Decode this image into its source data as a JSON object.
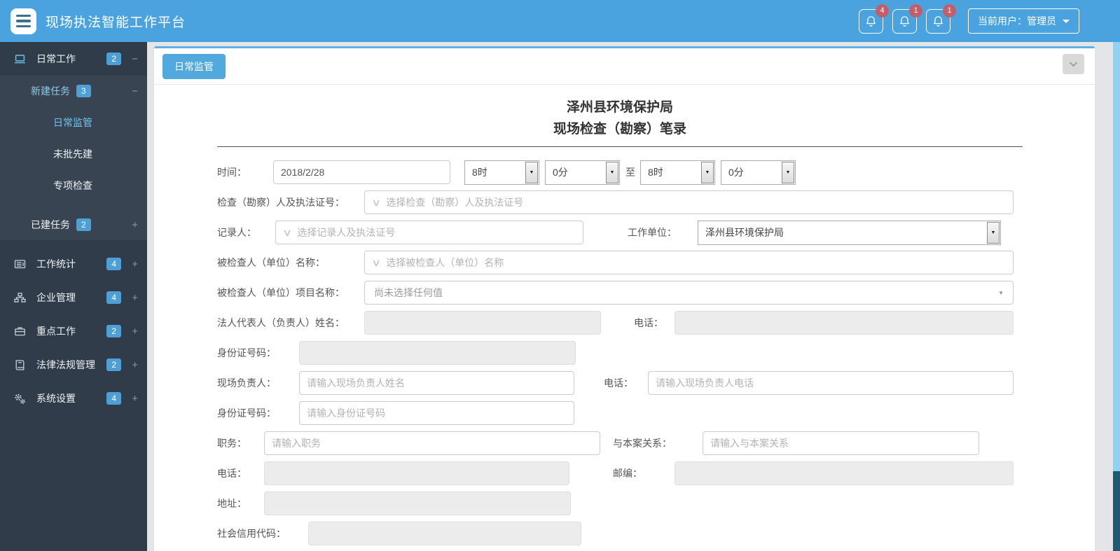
{
  "header": {
    "title": "现场执法智能工作平台",
    "notifications": [
      {
        "count": "4"
      },
      {
        "count": "1"
      },
      {
        "count": "1"
      }
    ],
    "user_label": "当前用户：管理员"
  },
  "icons": {
    "plus": "+",
    "minus": "−",
    "caret": "▼",
    "chevron": "∨"
  },
  "colors": {
    "header_bg": "#4AA3DF",
    "sidebar_bg": "#303C49",
    "submenu_bg": "#394452",
    "badge_bg": "#4E9FD6",
    "alert_badge_bg": "#CA5861",
    "active_text": "#6EC6F0",
    "tab_bg": "#52A9DD",
    "panel_top_border": "#5FB2E6",
    "scroll_thumb": "#8FD2F1",
    "scroll_track": "#1E5A74"
  },
  "sidebar": {
    "daily_work": {
      "label": "日常工作",
      "badge": "2"
    },
    "new_task": {
      "label": "新建任务",
      "badge": "3"
    },
    "children": [
      {
        "label": "日常监管"
      },
      {
        "label": "未批先建"
      },
      {
        "label": "专项检查"
      }
    ],
    "built_task": {
      "label": "已建任务",
      "badge": "2"
    },
    "items": [
      {
        "label": "工作统计",
        "badge": "4"
      },
      {
        "label": "企业管理",
        "badge": "4"
      },
      {
        "label": "重点工作",
        "badge": "2"
      },
      {
        "label": "法律法规管理",
        "badge": "2"
      },
      {
        "label": "系统设置",
        "badge": "4"
      }
    ]
  },
  "main": {
    "tab_label": "日常监管"
  },
  "form": {
    "title_line1": "泽州县环境保护局",
    "title_line2": "现场检查（勘察）笔录",
    "time_label": "时间：",
    "date_value": "2018/2/28",
    "start_hour": "8时",
    "start_minute": "0分",
    "range_separator": "至",
    "end_hour": "8时",
    "end_minute": "0分",
    "inspector_label": "检查（勘察）人及执法证号：",
    "inspector_placeholder": "选择检查（勘察）人及执法证号",
    "recorder_label": "记录人：",
    "recorder_placeholder": "选择记录人及执法证号",
    "work_unit_label": "工作单位：",
    "work_unit_value": "泽州县环境保护局",
    "inspected_name_label": "被检查人（单位）名称：",
    "inspected_name_placeholder": "选择被检查人（单位）名称",
    "inspected_project_label": "被检查人（单位）项目名称：",
    "inspected_project_value": "尚未选择任何值",
    "legal_rep_label": "法人代表人（负责人）姓名：",
    "legal_rep_phone_label": "电话：",
    "legal_rep_id_label": "身份证号码：",
    "site_manager_label": "现场负责人：",
    "site_manager_placeholder": "请输入现场负责人姓名",
    "site_manager_phone_label": "电话：",
    "site_manager_phone_placeholder": "请输入现场负责人电话",
    "site_manager_id_label": "身份证号码：",
    "site_manager_id_placeholder": "请输入身份证号码",
    "duty_label": "职务：",
    "duty_placeholder": "请输入职务",
    "relation_label": "与本案关系：",
    "relation_placeholder": "请输入与本案关系",
    "phone_label": "电话：",
    "zip_label": "邮编：",
    "address_label": "地址：",
    "credit_code_label": "社会信用代码："
  }
}
